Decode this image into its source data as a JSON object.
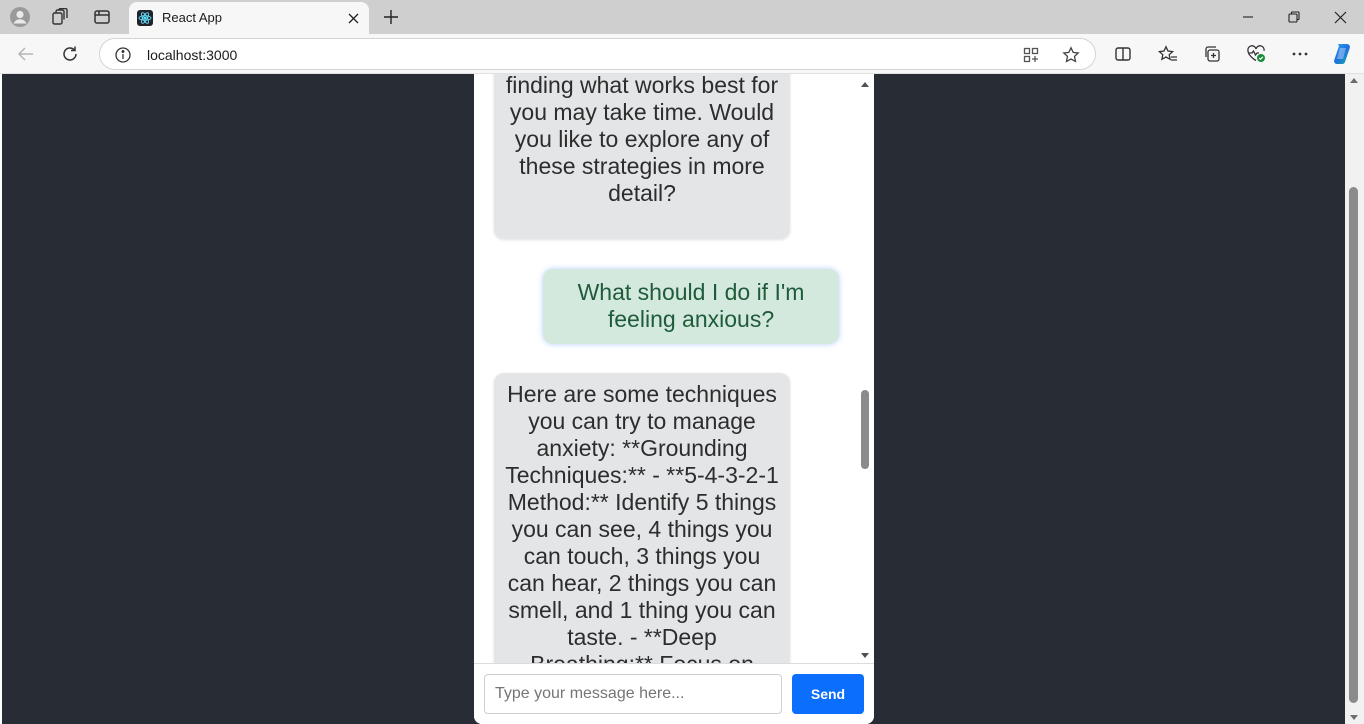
{
  "browser": {
    "tab_title": "React App",
    "url": "localhost:3000",
    "icons": [
      "profile-icon",
      "workspaces-icon",
      "tab-actions-icon",
      "react-favicon-icon",
      "close-tab-icon",
      "new-tab-icon",
      "minimize-icon",
      "restore-icon",
      "close-window-icon",
      "back-icon",
      "refresh-icon",
      "site-info-icon",
      "app-available-icon",
      "favorite-star-icon",
      "split-screen-icon",
      "favorites-icon",
      "collections-icon",
      "browser-essentials-icon",
      "more-icon",
      "copilot-icon"
    ]
  },
  "chat": {
    "messages": [
      {
        "sender": "bot",
        "text": "therapist. Remember, finding what works best for you may take time. Would you like to explore any of these strategies in more detail?"
      },
      {
        "sender": "user",
        "text": "What should I do if I'm feeling anxious?"
      },
      {
        "sender": "bot",
        "text": "Here are some techniques you can try to manage anxiety: **Grounding Techniques:** - **5-4-3-2-1 Method:** Identify 5 things you can see, 4 things you can touch, 3 things you can hear, 2 things you can smell, and 1 thing you can taste. - **Deep Breathing:** Focus on"
      }
    ],
    "input_placeholder": "Type your message here...",
    "send_label": "Send"
  },
  "colors": {
    "page_background": "#282c34",
    "bot_bubble": "#e4e5e7",
    "user_bubble": "#d3e9dd",
    "user_text": "#1f5b3a",
    "send_button": "#0b6efd"
  }
}
